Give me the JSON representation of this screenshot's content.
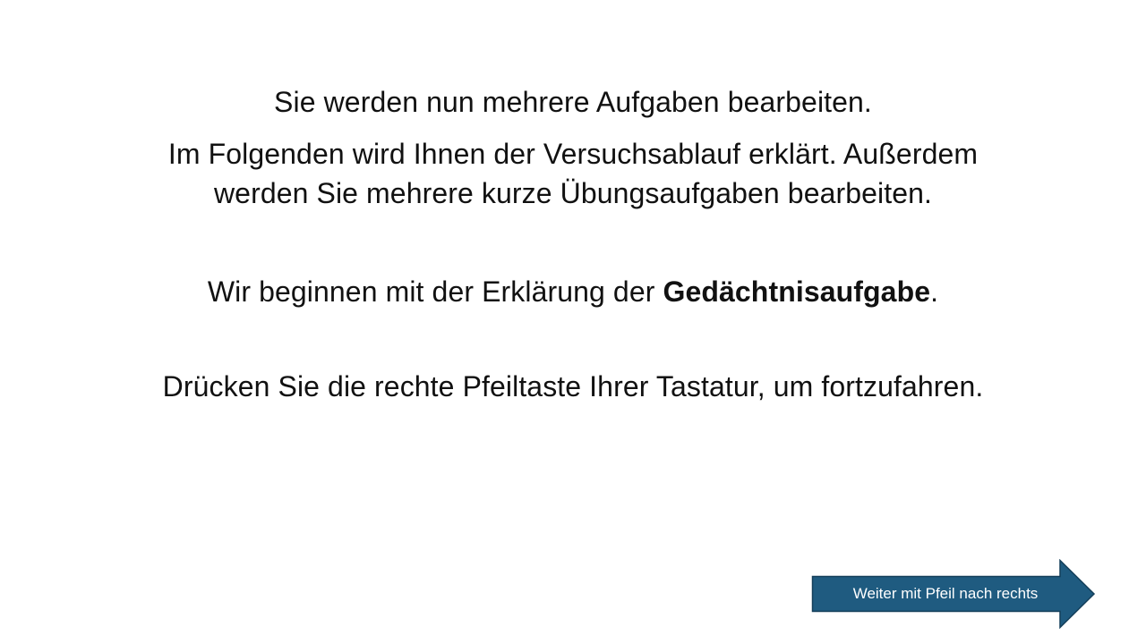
{
  "slide": {
    "line1": "Sie werden nun mehrere Aufgaben bearbeiten.",
    "line2": "Im Folgenden wird Ihnen der Versuchsablauf erklärt. Außerdem",
    "line3": "werden Sie mehrere kurze Übungsaufgaben bearbeiten.",
    "line4_prefix": "Wir beginnen mit der Erklärung der ",
    "line4_bold": "Gedächtnisaufgabe",
    "line4_suffix": ".",
    "line5": "Drücken Sie die rechte Pfeiltaste Ihrer Tastatur, um fortzufahren."
  },
  "next_button": {
    "label": "Weiter mit Pfeil nach rechts",
    "icon": "arrow-right-icon",
    "fill_color": "#1f5b80",
    "border_color": "#143f5a"
  }
}
